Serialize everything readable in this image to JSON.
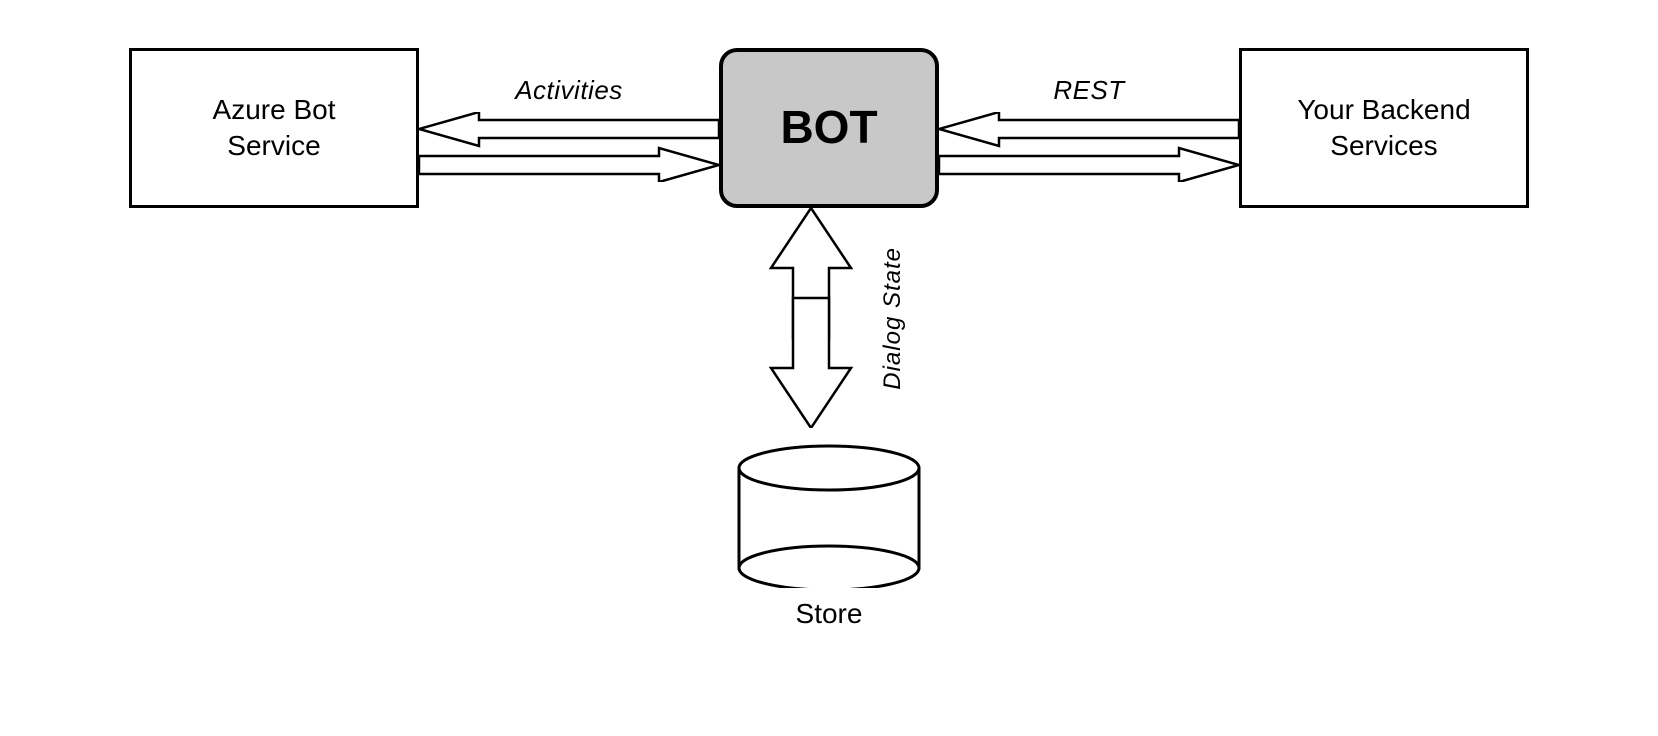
{
  "boxes": {
    "azure": "Azure Bot\nService",
    "bot": "BOT",
    "backend": "Your Backend\nServices"
  },
  "arrows": {
    "activities_label": "Activities",
    "rest_label": "REST",
    "dialog_state_label": "Dialog State"
  },
  "store": {
    "label": "Store"
  },
  "colors": {
    "background": "#ffffff",
    "box_border": "#000000",
    "bot_fill": "#c8c8c8",
    "arrow_fill": "#ffffff",
    "arrow_stroke": "#000000"
  }
}
